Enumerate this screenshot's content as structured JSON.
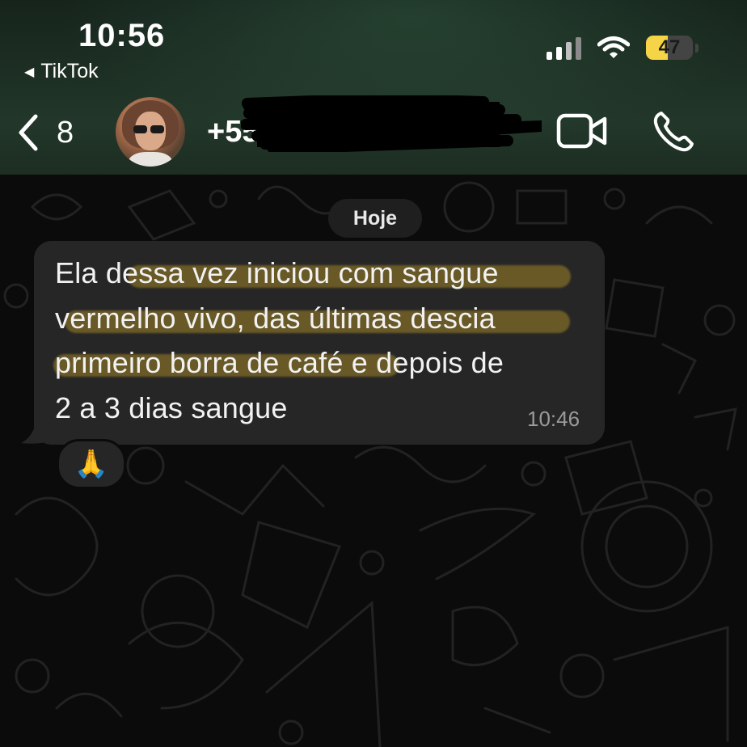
{
  "status_bar": {
    "time": "10:56",
    "back_app": "TikTok",
    "battery_level": "47",
    "battery_fraction": 0.47
  },
  "header": {
    "unread_count": "8",
    "contact_name": "+55",
    "icons": [
      "chevron-left-icon",
      "video-call-icon",
      "phone-icon"
    ]
  },
  "chat": {
    "date_label": "Hoje",
    "message": {
      "text": "Ela dessa vez iniciou com sangue\nvermelho vivo, das últimas descia\nprimeiro borra de café e depois de\n2 a 3 dias sangue",
      "time": "10:46",
      "reaction": "🙏"
    }
  },
  "colors": {
    "header_bg": "#1c2d22",
    "bubble": "#262626",
    "highlight": "#c4a028",
    "battery": "#f5d547"
  }
}
